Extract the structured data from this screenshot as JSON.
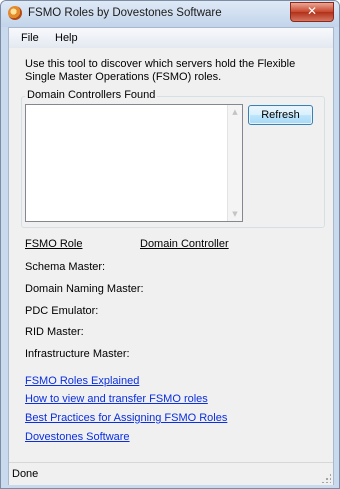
{
  "window": {
    "title": "FSMO Roles by Dovestones Software",
    "close_label": "✕"
  },
  "menu": {
    "items": [
      {
        "label": "File"
      },
      {
        "label": "Help"
      }
    ]
  },
  "intro_text": "Use this tool to discover which servers hold the Flexible Single Master Operations (FSMO) roles.",
  "dc_group": {
    "label": "Domain Controllers Found",
    "items": [],
    "refresh_label": "Refresh"
  },
  "roles": {
    "col_role": "FSMO Role",
    "col_dc": "Domain Controller",
    "items": [
      {
        "label": "Schema Master:",
        "value": ""
      },
      {
        "label": "Domain Naming Master:",
        "value": ""
      },
      {
        "label": "PDC Emulator:",
        "value": ""
      },
      {
        "label": "RID Master:",
        "value": ""
      },
      {
        "label": "Infrastructure Master:",
        "value": ""
      }
    ]
  },
  "links": [
    {
      "label": "FSMO Roles Explained"
    },
    {
      "label": "How to view and transfer FSMO roles"
    },
    {
      "label": "Best Practices for Assigning FSMO Roles"
    },
    {
      "label": "Dovestones Software"
    }
  ],
  "status": {
    "text": "Done"
  },
  "colors": {
    "link": "#0a2ee0",
    "frame": "#c9d9ee"
  },
  "icons": {
    "app": "app-icon",
    "close": "close-icon",
    "scroll_up": "scroll-up-icon",
    "scroll_down": "scroll-down-icon",
    "grip": "size-grip-icon"
  }
}
